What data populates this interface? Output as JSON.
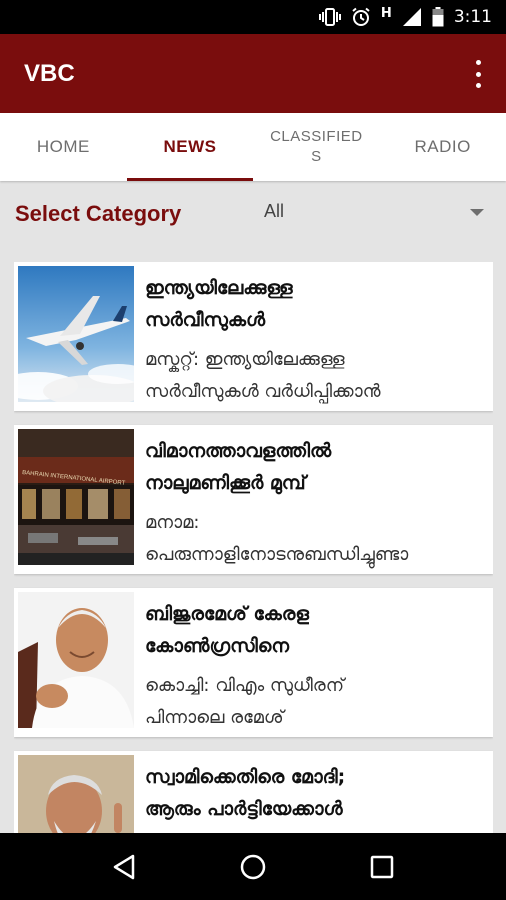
{
  "status_bar": {
    "time": "3:11",
    "network": "H",
    "icons": [
      "vibrate-icon",
      "alarm-icon",
      "signal-icon",
      "battery-icon"
    ]
  },
  "app_bar": {
    "title": "VBC",
    "menu_icon": "more-vert-icon"
  },
  "tabs": [
    {
      "label": "HOME",
      "active": false
    },
    {
      "label": "NEWS",
      "active": true
    },
    {
      "label": "CLASSIFIEDS",
      "active": false
    },
    {
      "label": "RADIO",
      "active": false
    }
  ],
  "filter": {
    "label": "Select Category",
    "selected": "All"
  },
  "news": [
    {
      "title_line1": "ഇന്ത്യയിലേക്കുള്ള",
      "title_line2": "സർവീസുകൾ",
      "desc_line1": "മസ്കറ്റ്: ഇന്ത്യയിലേക്കുള്ള",
      "desc_line2": "സർവീസുകൾ വർധിപ്പിക്കാൻ",
      "image": "airplane-photo"
    },
    {
      "title_line1": "വിമാനത്താവളത്തിൽ",
      "title_line2": "നാലുമണിക്കൂർ മുമ്പ്",
      "desc_line1": "മനാമ:",
      "desc_line2": "പെരുന്നാളിനോടനുബന്ധിച്ചുണ്ടാ",
      "image": "airport-terminal-photo",
      "image_text": "BAHRAIN INTERNATIONAL AIRPORT"
    },
    {
      "title_line1": "ബിജുരമേശ് കേരള",
      "title_line2": "കോൺഗ്രസിനെ",
      "desc_line1": "കൊച്ചി: വിഎം സുധീരന്",
      "desc_line2": "പിന്നാലെ രമേശ്",
      "image": "politician-portrait-photo"
    },
    {
      "title_line1": "സ്വാമിക്കെതിരെ മോദി;",
      "title_line2": "ആരും പാർട്ടിയേക്കാൾ",
      "desc_line1": "",
      "desc_line2": "",
      "image": "modi-portrait-photo"
    }
  ],
  "nav_bar": {
    "back": "back-icon",
    "home": "home-icon",
    "recents": "recents-icon"
  },
  "colors": {
    "primary": "#7a0d0d",
    "background": "#e4e4e4",
    "tab_inactive": "#6e6e6e"
  }
}
